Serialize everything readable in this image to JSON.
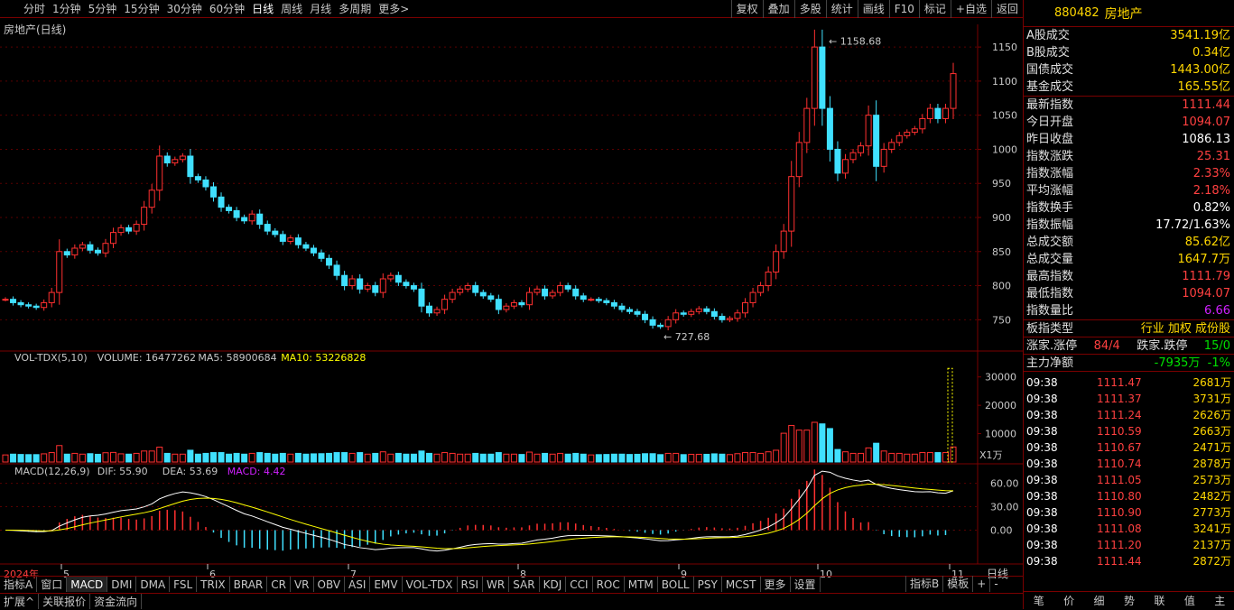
{
  "toolbar": {
    "periods": [
      "分时",
      "1分钟",
      "5分钟",
      "15分钟",
      "30分钟",
      "60分钟",
      "日线",
      "周线",
      "月线",
      "多周期",
      "更多>"
    ],
    "active_period": "日线",
    "right": [
      "复权",
      "叠加",
      "多股",
      "统计",
      "画线",
      "F10",
      "标记",
      "+自选",
      "返回"
    ]
  },
  "chart_label": "房地产(日线)",
  "price_axis": [
    "1150",
    "1100",
    "1050",
    "1000",
    "950",
    "900",
    "850",
    "800",
    "750"
  ],
  "vol_axis": [
    "30000",
    "20000",
    "10000"
  ],
  "vol_unit": "X1万",
  "macd_axis": [
    "60.00",
    "30.00",
    "0.00"
  ],
  "annotations": {
    "high": "1158.68",
    "low": "727.68"
  },
  "vol_header": {
    "name": "VOL-TDX(5,10)",
    "volume": "VOLUME: 16477262",
    "ma5": "MA5: 58900684",
    "ma10": "MA10: 53226828"
  },
  "macd_header": {
    "name": "MACD(12,26,9)",
    "dif": "DIF: 55.90",
    "dea": "DEA: 53.69",
    "macd": "MACD: 4.42"
  },
  "x_axis": {
    "year": "2024年",
    "months": [
      "5",
      "6",
      "7",
      "8",
      "9",
      "10",
      "11"
    ],
    "right_label": "日线"
  },
  "colors": {
    "up": "#ff3030",
    "down": "#40e0ff",
    "ma5": "#ffffff",
    "ma10": "#ffff00",
    "macd_purple": "#d020ff",
    "border": "#7a0000"
  },
  "tabs": [
    "指标A",
    "窗口",
    "MACD",
    "DMI",
    "DMA",
    "FSL",
    "TRIX",
    "BRAR",
    "CR",
    "VR",
    "OBV",
    "ASI",
    "EMV",
    "VOL-TDX",
    "RSI",
    "WR",
    "SAR",
    "KDJ",
    "CCI",
    "ROC",
    "MTM",
    "BOLL",
    "PSY",
    "MCST",
    "更多",
    "设置"
  ],
  "tabs_right": [
    "指标B",
    "模板",
    "+",
    "-"
  ],
  "tabs2": [
    "扩展^",
    "关联报价",
    "资金流向"
  ],
  "panel": {
    "code": "880482",
    "name": "房地产",
    "rows1": [
      {
        "k": "A股成交",
        "v": "3541.19亿",
        "c": "y"
      },
      {
        "k": "B股成交",
        "v": "0.34亿",
        "c": "y"
      },
      {
        "k": "国债成交",
        "v": "1443.00亿",
        "c": "y"
      },
      {
        "k": "基金成交",
        "v": "165.55亿",
        "c": "y"
      }
    ],
    "rows2": [
      {
        "k": "最新指数",
        "v": "1111.44",
        "c": "r"
      },
      {
        "k": "今日开盘",
        "v": "1094.07",
        "c": "r"
      },
      {
        "k": "昨日收盘",
        "v": "1086.13",
        "c": "w"
      },
      {
        "k": "指数涨跌",
        "v": "25.31",
        "c": "r"
      },
      {
        "k": "指数涨幅",
        "v": "2.33%",
        "c": "r"
      },
      {
        "k": "平均涨幅",
        "v": "2.18%",
        "c": "r"
      },
      {
        "k": "指数换手",
        "v": "0.82%",
        "c": "w"
      },
      {
        "k": "指数振幅",
        "v": "17.72/1.63%",
        "c": "w"
      },
      {
        "k": "总成交额",
        "v": "85.62亿",
        "c": "y"
      },
      {
        "k": "总成交量",
        "v": "1647.7万",
        "c": "y"
      },
      {
        "k": "最高指数",
        "v": "1111.79",
        "c": "r"
      },
      {
        "k": "最低指数",
        "v": "1094.07",
        "c": "r"
      },
      {
        "k": "指数量比",
        "v": "6.66",
        "c": "p"
      }
    ],
    "board_type": {
      "k": "板指类型",
      "v": "行业 加权 成份股"
    },
    "updown": {
      "k1": "涨家.涨停",
      "v1": "84/4",
      "k2": "跌家.跌停",
      "v2": "15/0"
    },
    "mainflow": {
      "k": "主力净额",
      "v1": "-7935万",
      "v2": "-1%"
    },
    "ticks": [
      {
        "t": "09:38",
        "p": "1111.47",
        "v": "2681万"
      },
      {
        "t": "09:38",
        "p": "1111.37",
        "v": "3731万"
      },
      {
        "t": "09:38",
        "p": "1111.24",
        "v": "2626万"
      },
      {
        "t": "09:38",
        "p": "1110.59",
        "v": "2663万"
      },
      {
        "t": "09:38",
        "p": "1110.67",
        "v": "2471万"
      },
      {
        "t": "09:38",
        "p": "1110.74",
        "v": "2878万"
      },
      {
        "t": "09:38",
        "p": "1111.05",
        "v": "2573万"
      },
      {
        "t": "09:38",
        "p": "1110.80",
        "v": "2482万"
      },
      {
        "t": "09:38",
        "p": "1110.90",
        "v": "2773万"
      },
      {
        "t": "09:38",
        "p": "1111.08",
        "v": "3241万"
      },
      {
        "t": "09:38",
        "p": "1111.20",
        "v": "2137万"
      },
      {
        "t": "09:38",
        "p": "1111.44",
        "v": "2872万"
      }
    ],
    "footer": [
      "笔",
      "价",
      "细",
      "势",
      "联",
      "值",
      "主"
    ]
  },
  "chart_data": {
    "type": "candlestick",
    "price_range": [
      720,
      1170
    ],
    "vol_range": [
      0,
      35000
    ],
    "macd_range": [
      -40,
      70
    ],
    "closes": [
      780,
      775,
      772,
      770,
      768,
      775,
      790,
      850,
      845,
      855,
      860,
      852,
      848,
      862,
      878,
      885,
      880,
      890,
      915,
      940,
      990,
      980,
      985,
      990,
      960,
      955,
      945,
      930,
      915,
      910,
      900,
      895,
      905,
      890,
      880,
      875,
      865,
      870,
      860,
      855,
      848,
      840,
      830,
      815,
      800,
      810,
      795,
      800,
      790,
      810,
      815,
      805,
      800,
      795,
      770,
      760,
      765,
      780,
      790,
      795,
      800,
      790,
      785,
      780,
      765,
      770,
      775,
      772,
      790,
      795,
      785,
      790,
      800,
      795,
      785,
      780,
      780,
      778,
      775,
      770,
      765,
      762,
      758,
      750,
      742,
      740,
      750,
      760,
      758,
      762,
      766,
      762,
      755,
      750,
      752,
      760,
      775,
      790,
      800,
      820,
      850,
      880,
      960,
      1010,
      1060,
      1150,
      1060,
      1000,
      965,
      985,
      995,
      1005,
      1050,
      975,
      1000,
      1010,
      1020,
      1025,
      1030,
      1045,
      1060,
      1045,
      1060,
      1111
    ]
  }
}
